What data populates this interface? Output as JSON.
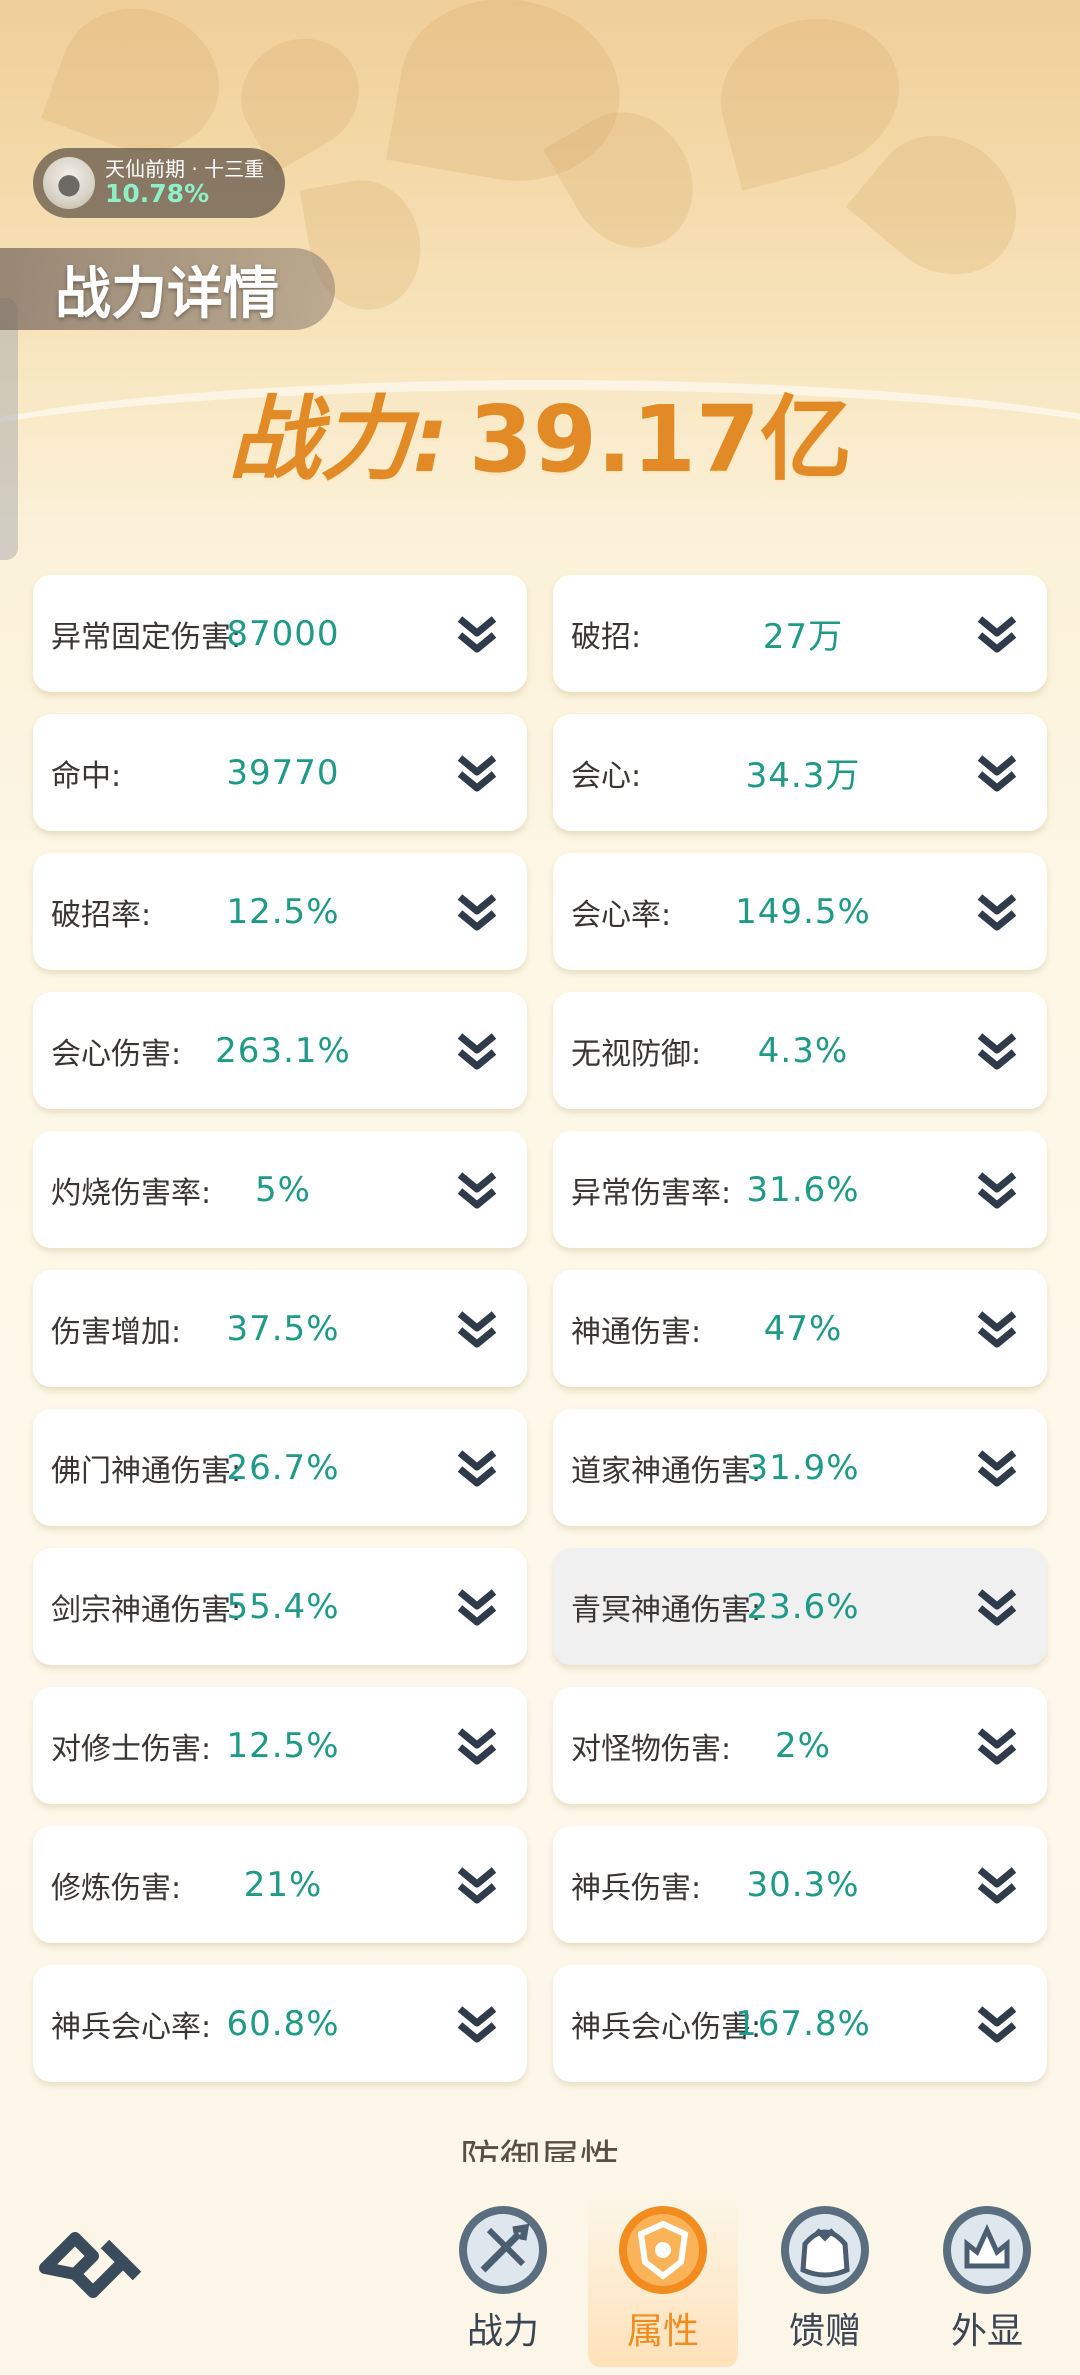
{
  "header": {
    "realm_name": "天仙前期 · 十三重",
    "realm_progress": "10.78%",
    "title": "战力详情"
  },
  "power": {
    "label": "战力:",
    "value": "39.17亿"
  },
  "stats": [
    {
      "label": "异常固定伤害:",
      "value": "87000"
    },
    {
      "label": "破招:",
      "value": "27万"
    },
    {
      "label": "命中:",
      "value": "39770"
    },
    {
      "label": "会心:",
      "value": "34.3万"
    },
    {
      "label": "破招率:",
      "value": "12.5%"
    },
    {
      "label": "会心率:",
      "value": "149.5%"
    },
    {
      "label": "会心伤害:",
      "value": "263.1%"
    },
    {
      "label": "无视防御:",
      "value": "4.3%"
    },
    {
      "label": "灼烧伤害率:",
      "value": "5%"
    },
    {
      "label": "异常伤害率:",
      "value": "31.6%"
    },
    {
      "label": "伤害增加:",
      "value": "37.5%"
    },
    {
      "label": "神通伤害:",
      "value": "47%"
    },
    {
      "label": "佛门神通伤害:",
      "value": "26.7%"
    },
    {
      "label": "道家神通伤害:",
      "value": "31.9%"
    },
    {
      "label": "剑宗神通伤害:",
      "value": "55.4%"
    },
    {
      "label": "青冥神通伤害:",
      "value": "23.6%"
    },
    {
      "label": "对修士伤害:",
      "value": "12.5%"
    },
    {
      "label": "对怪物伤害:",
      "value": "2%"
    },
    {
      "label": "修炼伤害:",
      "value": "21%"
    },
    {
      "label": "神兵伤害:",
      "value": "30.3%"
    },
    {
      "label": "神兵会心率:",
      "value": "60.8%"
    },
    {
      "label": "神兵会心伤害:",
      "value": "167.8%"
    }
  ],
  "sub_section_title": "防御属性",
  "nav": {
    "items": [
      {
        "label": "战力",
        "icon": "sword-icon"
      },
      {
        "label": "属性",
        "icon": "shield-icon",
        "active": true
      },
      {
        "label": "馈赠",
        "icon": "gift-bag-icon"
      },
      {
        "label": "外显",
        "icon": "crown-icon"
      }
    ]
  },
  "colors": {
    "accent": "#e28a25",
    "value_teal": "#1f9a87",
    "nav_active": "#f28c1f",
    "nav_inactive": "#3c4553"
  }
}
